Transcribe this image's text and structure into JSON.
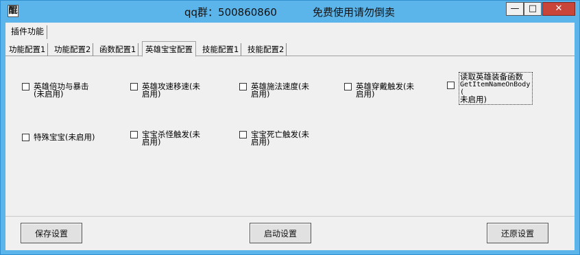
{
  "window": {
    "icon_glyph": "醌",
    "title_group": "qq群：500860860",
    "title_note": "免费使用请勿倒卖",
    "min_label": "—",
    "max_label": "□",
    "close_label": "✕"
  },
  "plugin_tab": {
    "label": "插件功能"
  },
  "tabs": [
    {
      "label": "功能配置1"
    },
    {
      "label": "功能配置2"
    },
    {
      "label": "函数配置1"
    },
    {
      "label": "英雄宝宝配置"
    },
    {
      "label": "技能配置1"
    },
    {
      "label": "技能配置2"
    }
  ],
  "checkboxes": [
    {
      "label": "英雄倍功与暴击(未启用)"
    },
    {
      "label": "英雄攻速移速(未启用)"
    },
    {
      "label": "英雄施法速度(未启用)"
    },
    {
      "label": "英雄穿戴触发(未启用)"
    },
    {
      "label_line1": "读取英雄装备函数",
      "label_line2": "GetItemNameOnBody(",
      "label_line3": "未启用)"
    },
    {
      "label": "特殊宝宝(未启用)"
    },
    {
      "label": "宝宝杀怪触发(未启用)"
    },
    {
      "label": "宝宝死亡触发(未启用)"
    }
  ],
  "buttons": {
    "save": "保存设置",
    "start": "启动设置",
    "restore": "还原设置"
  }
}
